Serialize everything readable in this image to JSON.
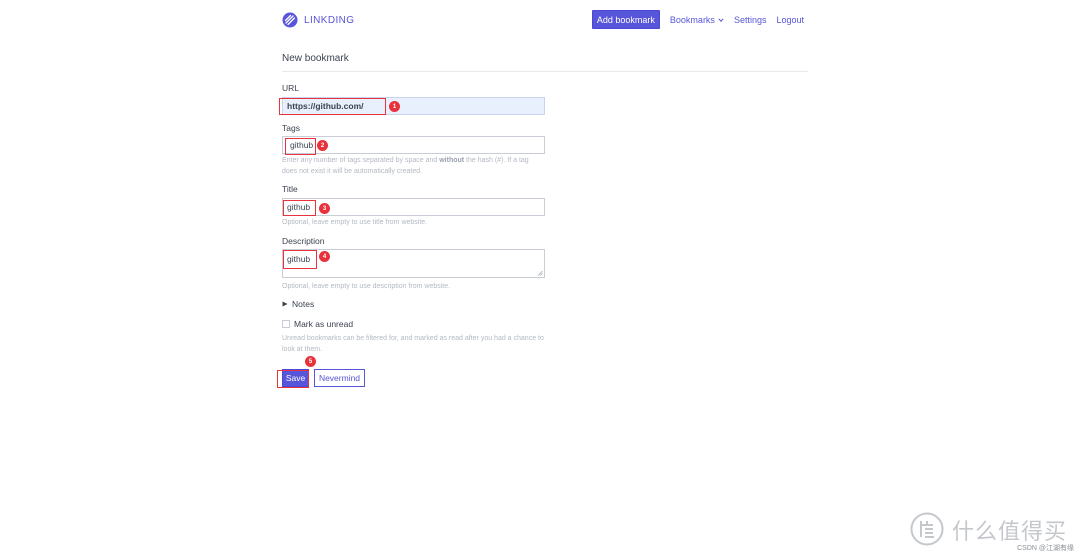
{
  "header": {
    "brand": "LINKDING",
    "add_bookmark": "Add bookmark",
    "bookmarks": "Bookmarks",
    "settings": "Settings",
    "logout": "Logout"
  },
  "page": {
    "title": "New bookmark"
  },
  "form": {
    "url": {
      "label": "URL",
      "value": "https://github.com/"
    },
    "tags": {
      "label": "Tags",
      "value": "github",
      "hint_pre": "Enter any number of tags separated by space and ",
      "hint_bold": "without",
      "hint_post": " the hash (#). If a tag does not exist it will be automatically created."
    },
    "title": {
      "label": "Title",
      "value": "github",
      "hint": "Optional, leave empty to use title from website."
    },
    "description": {
      "label": "Description",
      "value": "github",
      "hint": "Optional, leave empty to use description from website."
    },
    "notes": {
      "label": "Notes"
    },
    "unread": {
      "label": "Mark as unread",
      "checked": false,
      "hint": "Unread bookmarks can be filtered for, and marked as read after you had a chance to look at them."
    },
    "save": "Save",
    "cancel": "Nevermind"
  },
  "annotations": [
    "1",
    "2",
    "3",
    "4",
    "5"
  ],
  "watermark": {
    "text": "什么值得买",
    "small": "CSDN @江湖有缘"
  },
  "colors": {
    "accent": "#5755d9",
    "annotation": "#e8323c",
    "autofill": "#e8f0fe"
  },
  "icons": {
    "brand": "linkding-logo-icon",
    "dropdown": "chevron-down-icon",
    "notes": "caret-right-icon",
    "watermark": "zhi-icon"
  }
}
